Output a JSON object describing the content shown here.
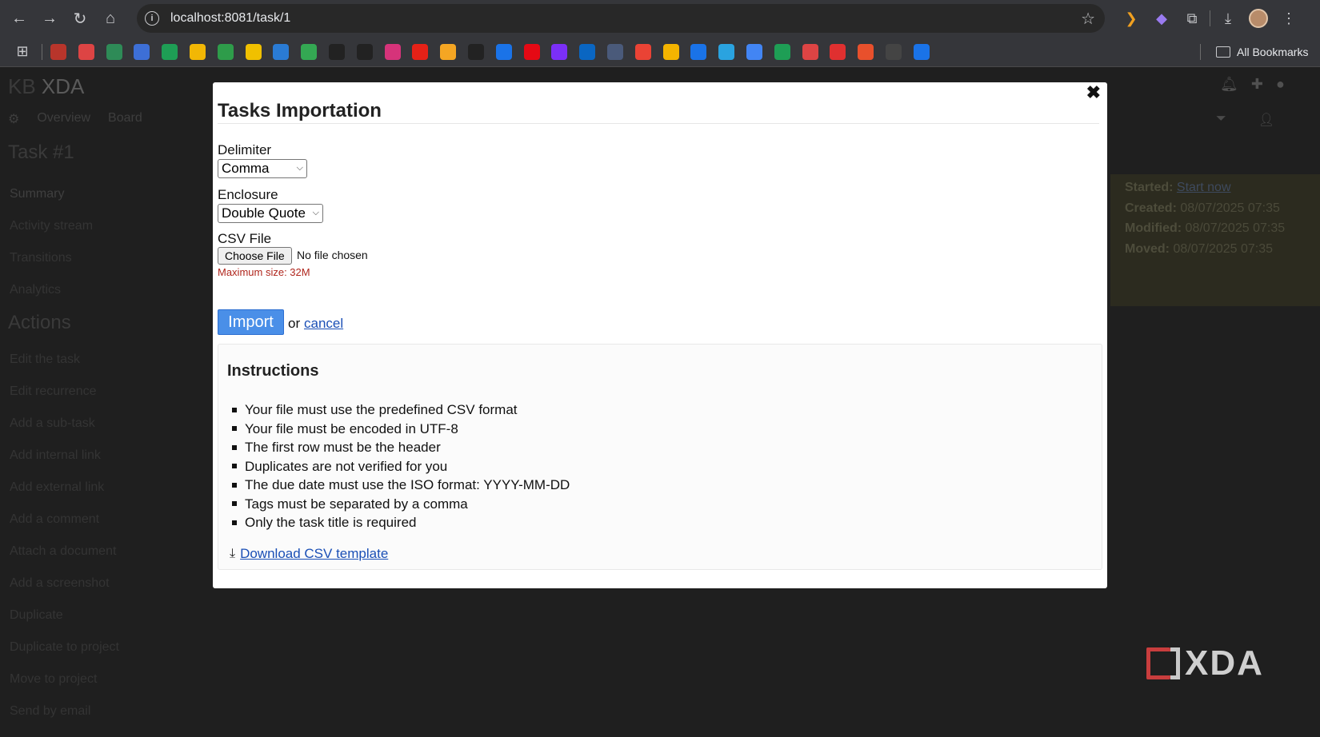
{
  "browser": {
    "url": "localhost:8081/task/1",
    "all_bookmarks_label": "All Bookmarks",
    "bookmark_colors": [
      "#b8352b",
      "#d44",
      "#2e8b57",
      "#3d6fd6",
      "#1e9e55",
      "#f2b705",
      "#2e9c4a",
      "#f0c000",
      "#2a7bd4",
      "#34a853",
      "#222",
      "#222",
      "#d6337a",
      "#e62117",
      "#f5a623",
      "#222",
      "#1a73e8",
      "#e50914",
      "#7b2ff7",
      "#0a66c2",
      "#4a5a7a",
      "#ea4335",
      "#f4b400",
      "#1a73e8",
      "#2aa3e0",
      "#4285f4",
      "#1e9e55",
      "#d44",
      "#e03030",
      "#e8502c",
      "#444",
      "#1a73e8"
    ]
  },
  "background": {
    "app_name": "KB",
    "project_name": "XDA",
    "views": [
      "Overview",
      "Board"
    ],
    "task_heading": "Task #1",
    "sidebar": [
      "Summary",
      "Activity stream",
      "Transitions",
      "Analytics"
    ],
    "actions_heading": "Actions",
    "actions": [
      "Edit the task",
      "Edit recurrence",
      "Add a sub-task",
      "Add internal link",
      "Add external link",
      "Add a comment",
      "Attach a document",
      "Add a screenshot",
      "Duplicate",
      "Duplicate to project",
      "Move to project",
      "Send by email"
    ],
    "summary": {
      "started_label": "Started:",
      "started_value": "Start now",
      "created_label": "Created:",
      "created_value": "08/07/2025 07:35",
      "modified_label": "Modified:",
      "modified_value": "08/07/2025 07:35",
      "moved_label": "Moved:",
      "moved_value": "08/07/2025 07:35"
    },
    "watermark": "XDA"
  },
  "modal": {
    "close_glyph": "✖",
    "title": "Tasks Importation",
    "delimiter_label": "Delimiter",
    "delimiter_value": "Comma",
    "enclosure_label": "Enclosure",
    "enclosure_value": "Double Quote",
    "csv_label": "CSV File",
    "choose_file_label": "Choose File",
    "file_status": "No file chosen",
    "max_size": "Maximum size: 32M",
    "import_label": "Import",
    "or_text": "or",
    "cancel_label": "cancel",
    "instructions_title": "Instructions",
    "instructions": [
      "Your file must use the predefined CSV format",
      "Your file must be encoded in UTF-8",
      "The first row must be the header",
      "Duplicates are not verified for you",
      "The due date must use the ISO format: YYYY-MM-DD",
      "Tags must be separated by a comma",
      "Only the task title is required"
    ],
    "download_label": "Download CSV template"
  }
}
